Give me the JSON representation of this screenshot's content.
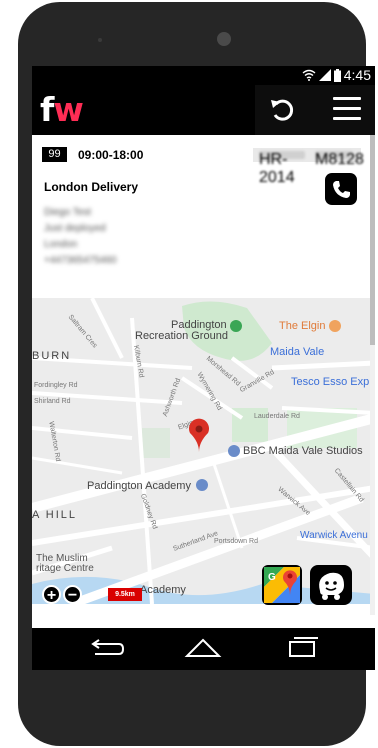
{
  "status_bar": {
    "clock": "4:45"
  },
  "header": {
    "logo_f": "f",
    "logo_w": "w"
  },
  "delivery": {
    "badge": "99",
    "time_window": "09:00-18:00",
    "title": "London Delivery",
    "blurred_lines": [
      "Diego Test",
      "Just deployed",
      "London",
      "+447365475460"
    ],
    "pills": [
      "HR-2014",
      "M8128"
    ]
  },
  "map": {
    "labels": {
      "paddington_rec": "Paddington",
      "paddington_rec2": "Recreation Ground",
      "the_elgin": "The Elgin",
      "maida_vale": "Maida Vale",
      "tesco": "Tesco Esso Exp",
      "bbc": "BBC Maida Vale Studios",
      "academy": "Paddington Academy",
      "burn": "BURN",
      "hill": "A HILL",
      "warwick_ave": "Warwick Avenu",
      "muslim1": "The Muslim",
      "muslim2": "ritage Centre",
      "academy2": "Academy",
      "elgin_ave": "Elgin",
      "sutherland": "Sutherland Ave",
      "warwick": "Warwick Ave",
      "lauderdale": "Lauderdale Rd",
      "castellain": "Castellain Rd",
      "portsdown": "Portsdown Rd",
      "shirland": "Shirland Rd",
      "fordingley": "Fordingley Rd",
      "wymering": "Wymering Rd",
      "ashworth": "Ashworth Rd",
      "morshead": "Morshead Rd",
      "granville": "Granville Rd",
      "goldney": "Goldney Rd",
      "walterton": "Walterton Rd",
      "kilburn": "Kilburn Rd",
      "saltram": "Saltram Cres"
    },
    "zoom_in": "+",
    "zoom_out": "−",
    "scale": "9.5km",
    "colors": {
      "park": "#c5e8c5",
      "road": "#ffffff",
      "water": "#aadaff",
      "pin": "#e53935"
    }
  },
  "icons": {
    "wifi": "wifi-icon",
    "signal": "signal-icon",
    "battery": "battery-icon",
    "refresh": "refresh-icon",
    "menu": "menu-icon",
    "phone": "phone-icon",
    "pin": "map-pin-icon",
    "google_maps": "google-maps-icon",
    "waze": "waze-icon"
  }
}
